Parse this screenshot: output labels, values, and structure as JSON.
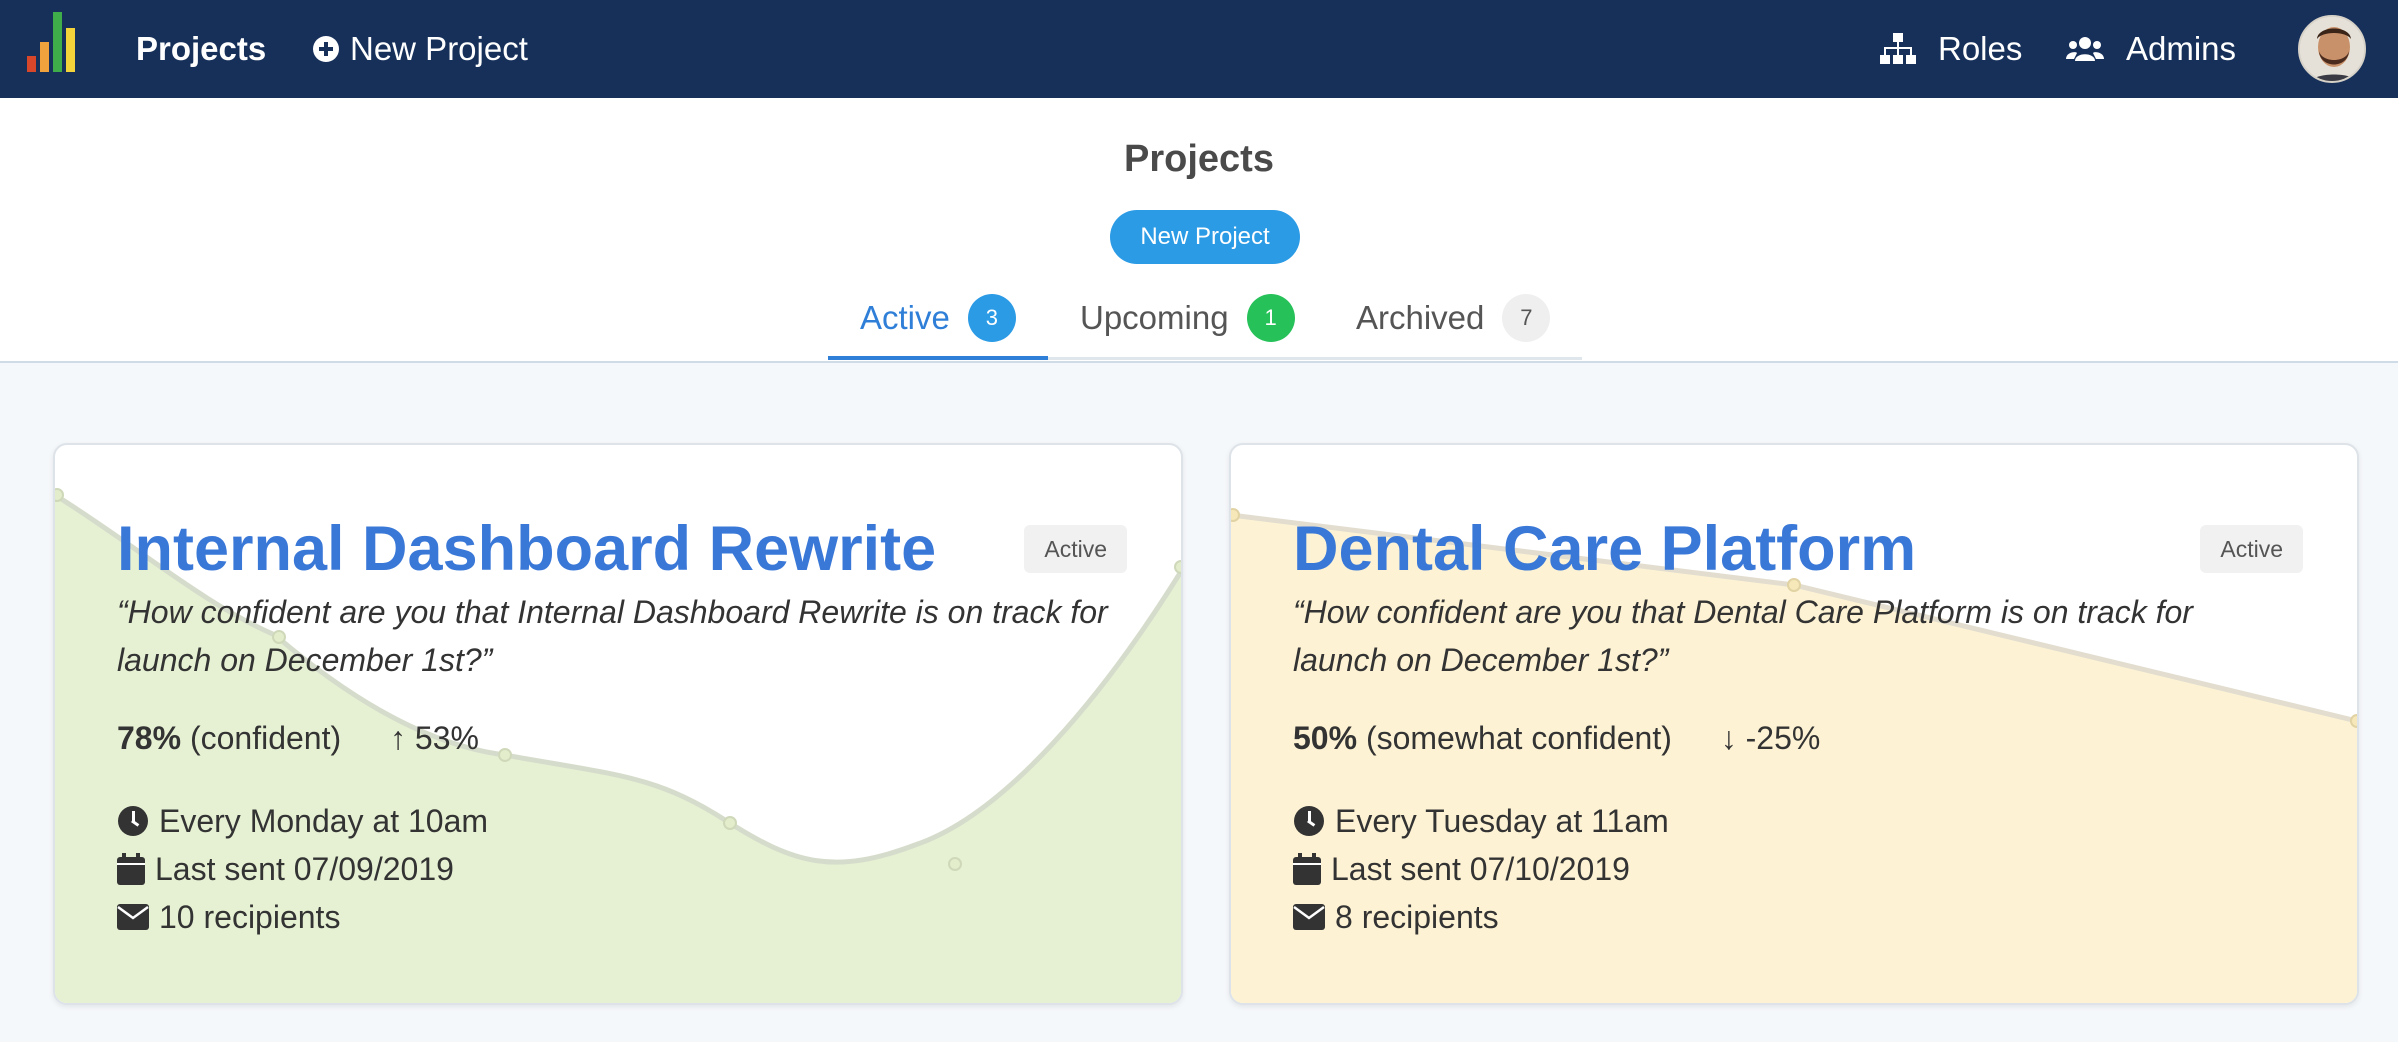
{
  "navbar": {
    "brand": "Projects",
    "new_project": "New Project",
    "roles": "Roles",
    "admins": "Admins",
    "logo_colors": [
      "#d9472b",
      "#f0a23c",
      "#8cc63f",
      "#3fae4a",
      "#f3d23a"
    ]
  },
  "header": {
    "title": "Projects",
    "new_button": "New Project",
    "tabs": [
      {
        "label": "Active",
        "count": "3"
      },
      {
        "label": "Upcoming",
        "count": "1"
      },
      {
        "label": "Archived",
        "count": "7"
      }
    ]
  },
  "projects": [
    {
      "title": "Internal Dashboard Rewrite",
      "status": "Active",
      "question": "“How confident are you that Internal Dashboard Rewrite is on track for launch on December 1st?”",
      "percent": "78%",
      "confidence": "(confident)",
      "trend": "↑ 53%",
      "schedule": "Every Monday at 10am",
      "last_sent": "Last sent 07/09/2019",
      "recipients": "10 recipients",
      "accent_fill": "#e6f1d3"
    },
    {
      "title": "Dental Care Platform",
      "status": "Active",
      "question": "“How confident are you that Dental Care Platform is on track for launch on December 1st?”",
      "percent": "50%",
      "confidence": "(somewhat confident)",
      "trend": "↓ -25%",
      "schedule": "Every Tuesday at 11am",
      "last_sent": "Last sent 07/10/2019",
      "recipients": "8 recipients",
      "accent_fill": "#fdf3d4"
    }
  ]
}
